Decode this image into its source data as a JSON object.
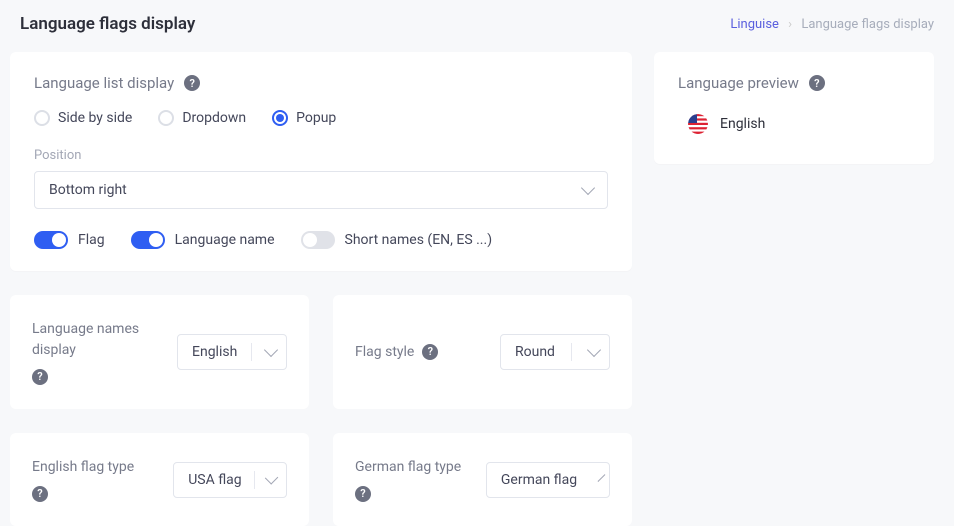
{
  "header": {
    "title": "Language flags display",
    "breadcrumb": {
      "root": "Linguise",
      "current": "Language flags display"
    }
  },
  "listDisplay": {
    "title": "Language list display",
    "modes": {
      "sideBySide": "Side by side",
      "dropdown": "Dropdown",
      "popup": "Popup"
    },
    "positionLabel": "Position",
    "positionValue": "Bottom right",
    "toggles": {
      "flag": "Flag",
      "languageName": "Language name",
      "shortNames": "Short names (EN, ES ...)"
    }
  },
  "namesDisplay": {
    "label": "Language names display",
    "value": "English"
  },
  "flagStyle": {
    "label": "Flag style",
    "value": "Round"
  },
  "englishFlag": {
    "label": "English flag type",
    "value": "USA flag"
  },
  "germanFlag": {
    "label": "German flag type",
    "value": "German flag"
  },
  "preview": {
    "title": "Language preview",
    "item": "English"
  }
}
